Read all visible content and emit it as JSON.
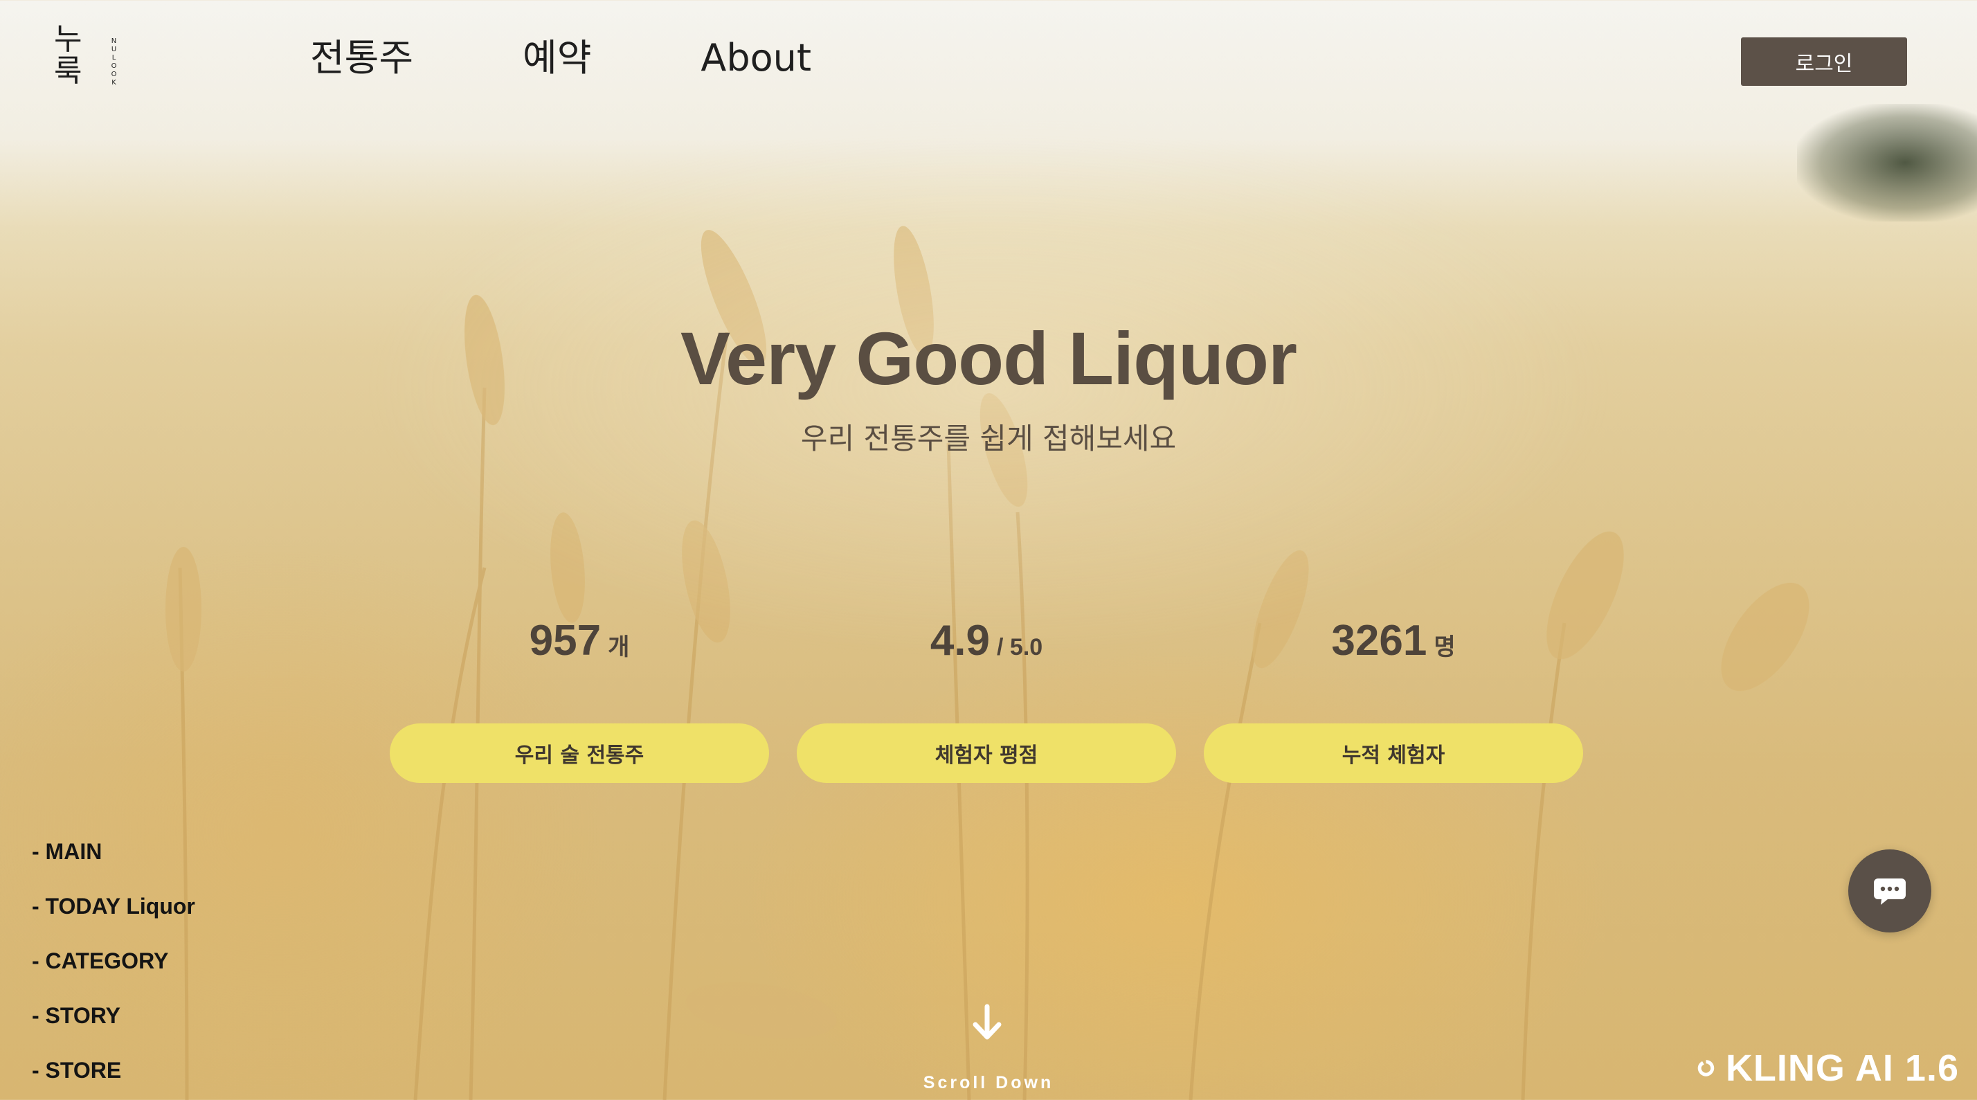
{
  "header": {
    "logo_text": "누룩",
    "logo_sub": "NULOOK",
    "nav": [
      {
        "label": "전통주"
      },
      {
        "label": "예약"
      },
      {
        "label": "About"
      }
    ],
    "login_label": "로그인"
  },
  "hero": {
    "title": "Very Good Liquor",
    "subtitle": "우리 전통주를 쉽게 접해보세요"
  },
  "stats": [
    {
      "value": "957",
      "unit": "개",
      "label": "우리 술 전통주"
    },
    {
      "value": "4.9",
      "unit": "/ 5.0",
      "label": "체험자 평점"
    },
    {
      "value": "3261",
      "unit": "명",
      "label": "누적 체험자"
    }
  ],
  "side_nav": [
    {
      "label": "- MAIN"
    },
    {
      "label": "- TODAY Liquor"
    },
    {
      "label": "- CATEGORY"
    },
    {
      "label": "- STORY"
    },
    {
      "label": "- STORE"
    }
  ],
  "scroll": {
    "label": "Scroll Down",
    "icon": "arrow-down-icon"
  },
  "chat": {
    "icon": "chat-bubble-icon"
  },
  "watermark": {
    "text": "KLING AI 1.6",
    "icon": "kling-logo-icon"
  },
  "colors": {
    "login_bg": "#5c5148",
    "pill_bg": "#efe168",
    "title_color": "#5a4e42",
    "chat_bg": "#5a5048"
  }
}
